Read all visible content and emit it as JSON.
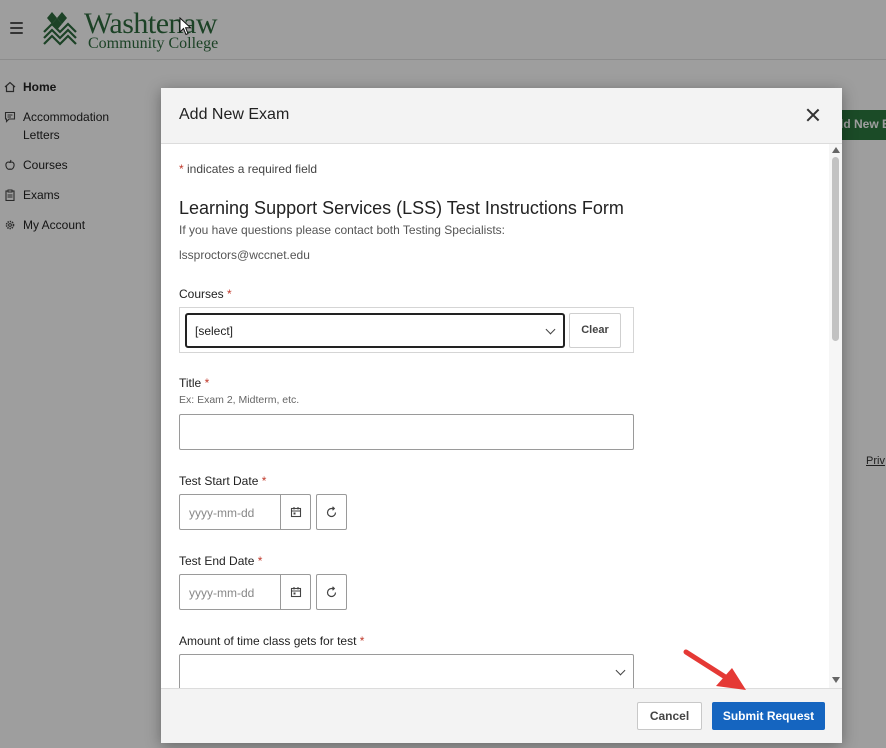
{
  "header": {
    "logo_line1": "Washtenaw",
    "logo_line2": "Community College"
  },
  "sidebar": {
    "items": [
      {
        "label": "Home",
        "icon": "home-icon",
        "active": true
      },
      {
        "label": "Accommodation Letters",
        "icon": "message-icon",
        "active": false
      },
      {
        "label": "Courses",
        "icon": "apple-icon",
        "active": false
      },
      {
        "label": "Exams",
        "icon": "clipboard-icon",
        "active": false
      },
      {
        "label": "My Account",
        "icon": "gear-icon",
        "active": false
      }
    ]
  },
  "background": {
    "add_button_fragment": "dd New E",
    "privacy_fragment": "Priv"
  },
  "modal": {
    "title": "Add New Exam",
    "required_note": "indicates a required field",
    "required_marker": "*",
    "form_heading": "Learning Support Services (LSS) Test Instructions Form",
    "form_sub": "If you have questions please contact both Testing Specialists:",
    "form_email": "lssproctors@wccnet.edu",
    "courses": {
      "label": "Courses",
      "selected": "[select]",
      "clear_label": "Clear"
    },
    "title_field": {
      "label": "Title",
      "hint": "Ex: Exam 2, Midterm, etc.",
      "value": ""
    },
    "start_date": {
      "label": "Test Start Date",
      "placeholder": "yyyy-mm-dd"
    },
    "end_date": {
      "label": "Test End Date",
      "placeholder": "yyyy-mm-dd"
    },
    "time_field": {
      "label": "Amount of time class gets for test",
      "selected": ""
    },
    "footer": {
      "cancel_label": "Cancel",
      "submit_label": "Submit Request"
    }
  },
  "colors": {
    "brand_green": "#2e6b3e",
    "primary_blue": "#1565c0",
    "required_red": "#c0392b",
    "arrow_red": "#e53935"
  }
}
